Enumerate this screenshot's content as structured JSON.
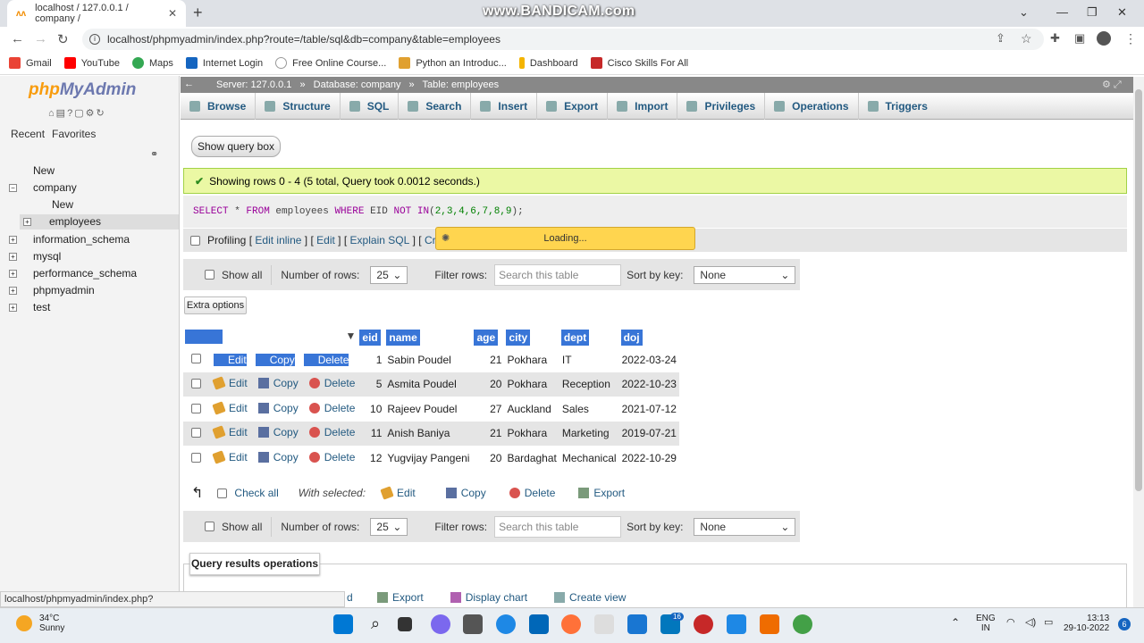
{
  "browser": {
    "tab_title": "localhost / 127.0.0.1 / company /",
    "watermark": "www.BANDICAM.com",
    "url": "localhost/phpmyadmin/index.php?route=/table/sql&db=company&table=employees",
    "bookmarks": [
      "Gmail",
      "YouTube",
      "Maps",
      "Internet Login",
      "Free Online Course...",
      "Python an Introduc...",
      "Dashboard",
      "Cisco Skills For All"
    ]
  },
  "sidebar": {
    "logo_php": "php",
    "logo_myadmin": "MyAdmin",
    "tabs": [
      "Recent",
      "Favorites"
    ],
    "tree": [
      "New",
      "company",
      "New",
      "employees",
      "information_schema",
      "mysql",
      "performance_schema",
      "phpmyadmin",
      "test"
    ]
  },
  "breadcrumb": {
    "server": "Server: 127.0.0.1",
    "database": "Database: company",
    "table": "Table: employees",
    "sep": "»"
  },
  "menu": [
    "Browse",
    "Structure",
    "SQL",
    "Search",
    "Insert",
    "Export",
    "Import",
    "Privileges",
    "Operations",
    "Triggers"
  ],
  "show_query_box": "Show query box",
  "success_message": "Showing rows 0 - 4 (5 total, Query took 0.0012 seconds.)",
  "sql": {
    "select": "SELECT",
    "star": " * ",
    "from": "FROM",
    "table": " employees ",
    "where": "WHERE",
    "col": " EID ",
    "not_in": "NOT IN",
    "list_open": "(",
    "list_values": "2,3,4,6,7,8,9",
    "list_close": ");"
  },
  "profiling": {
    "label": "Profiling",
    "bracket_open": "[",
    "bracket_close": "]",
    "links": [
      "Edit inline",
      "Edit",
      "Explain SQL",
      "Create"
    ]
  },
  "loading": "Loading...",
  "nav": {
    "show_all": "Show all",
    "rows_label": "Number of rows:",
    "rows_value": "25",
    "filter_label": "Filter rows:",
    "filter_placeholder": "Search this table",
    "sort_label": "Sort by key:",
    "sort_value": "None"
  },
  "extra_options": "Extra options",
  "table": {
    "columns": [
      "eid",
      "name",
      "age",
      "city",
      "dept",
      "doj"
    ],
    "actions": [
      "Edit",
      "Copy",
      "Delete"
    ],
    "rows": [
      [
        "1",
        "Sabin Poudel",
        "21",
        "Pokhara",
        "IT",
        "2022-03-24"
      ],
      [
        "5",
        "Asmita Poudel",
        "20",
        "Pokhara",
        "Reception",
        "2022-10-23"
      ],
      [
        "10",
        "Rajeev Poudel",
        "27",
        "Auckland",
        "Sales",
        "2021-07-12"
      ],
      [
        "11",
        "Anish Baniya",
        "21",
        "Pokhara",
        "Marketing",
        "2019-07-21"
      ],
      [
        "12",
        "Yugvijay Pangeni",
        "20",
        "Bardaghat",
        "Mechanical",
        "2022-10-29"
      ]
    ]
  },
  "with_selected": {
    "check_all": "Check all",
    "label": "With selected:",
    "edit": "Edit",
    "copy": "Copy",
    "delete": "Delete",
    "export": "Export"
  },
  "query_results_operations": "Query results operations",
  "bottom_actions": [
    "Export",
    "Display chart",
    "Create view"
  ],
  "bottom_partial": "d",
  "status_url": "localhost/phpmyadmin/index.php?route=/table/sql&db=company&table=employees",
  "taskbar": {
    "temp": "34°C",
    "weather": "Sunny",
    "lang1": "ENG",
    "lang2": "IN",
    "time": "13:13",
    "date": "29-10-2022",
    "notif": "6",
    "badge": "16"
  }
}
